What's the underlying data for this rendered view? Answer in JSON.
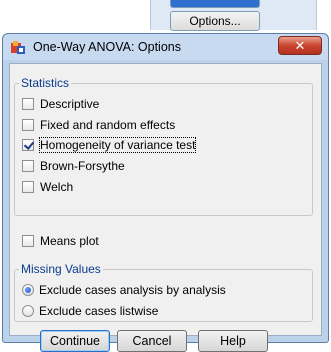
{
  "background_window": {
    "options_button_label": "Options..."
  },
  "dialog": {
    "title": "One-Way ANOVA: Options",
    "close_label": "✕",
    "statistics": {
      "legend": "Statistics",
      "items": [
        {
          "label": "Descriptive",
          "checked": false
        },
        {
          "label": "Fixed and random effects",
          "checked": false
        },
        {
          "label": "Homogeneity of variance test",
          "checked": true
        },
        {
          "label": "Brown-Forsythe",
          "checked": false
        },
        {
          "label": "Welch",
          "checked": false
        }
      ]
    },
    "means_plot": {
      "label": "Means plot",
      "checked": false
    },
    "missing_values": {
      "legend": "Missing Values",
      "options": [
        {
          "label": "Exclude cases analysis by analysis",
          "selected": true
        },
        {
          "label": "Exclude cases listwise",
          "selected": false
        }
      ]
    },
    "buttons": {
      "continue": "Continue",
      "cancel": "Cancel",
      "help": "Help"
    }
  },
  "colors": {
    "title_bar": "#c7daf0",
    "close_button": "#c9452f",
    "group_legend": "#0b3b8c"
  }
}
